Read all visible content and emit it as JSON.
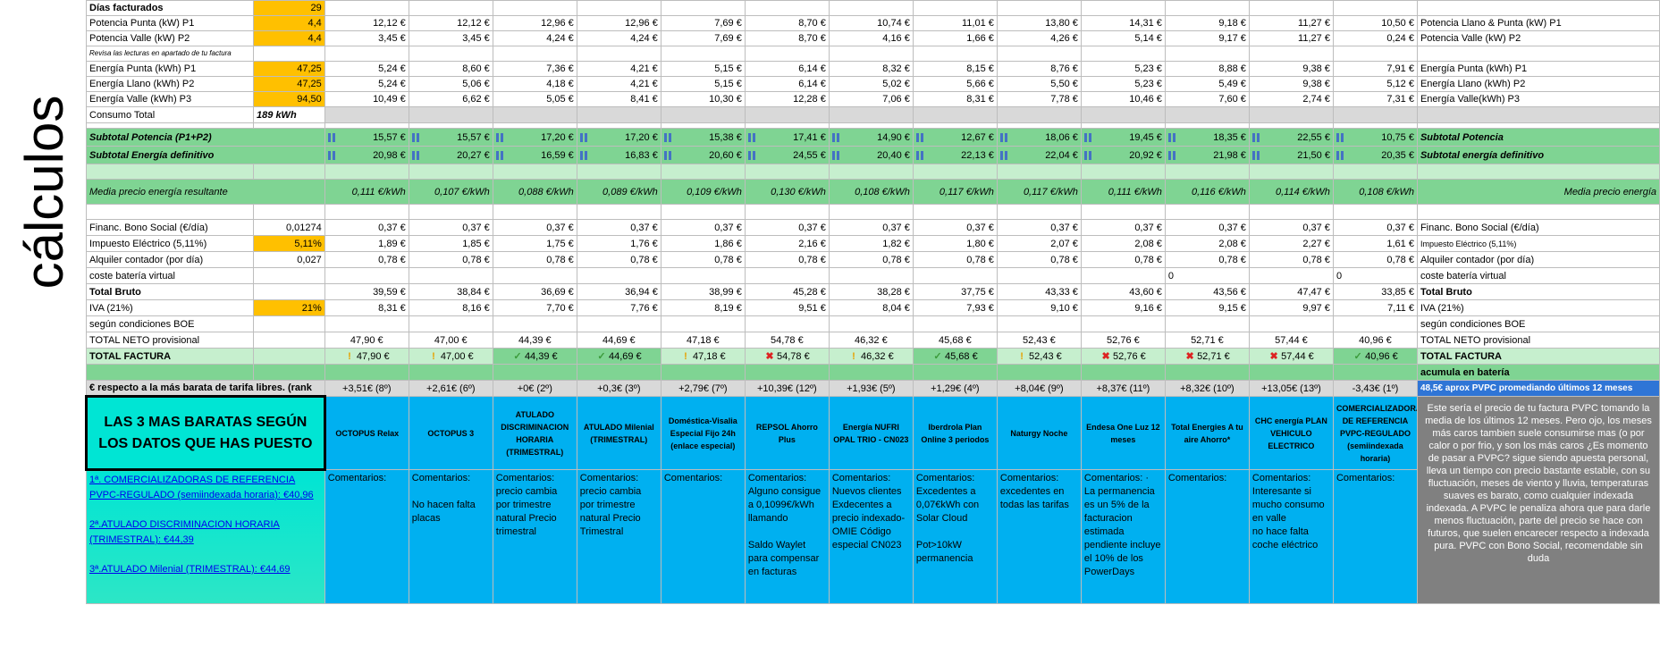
{
  "side_label": "cálculos",
  "providers": [
    {
      "name": "OCTOPUS Relax",
      "comment": "Comentarios:",
      "rank": "+3,51€ (8º)",
      "total": "47,90 €",
      "status": "warn"
    },
    {
      "name": "OCTOPUS 3",
      "comment": "Comentarios:\n\nNo hacen falta placas",
      "rank": "+2,61€ (6º)",
      "total": "47,00 €",
      "status": "warn"
    },
    {
      "name": "ATULADO DISCRIMINACION HORARIA (TRIMESTRAL)",
      "comment": "Comentarios: precio cambia por trimestre natural Precio trimestral",
      "rank": "+0€ (2º)",
      "total": "44,39 €",
      "status": "ok"
    },
    {
      "name": "ATULADO Milenial (TRIMESTRAL)",
      "comment": "Comentarios: precio cambia por trimestre natural Precio Trimestral",
      "rank": "+0,3€ (3º)",
      "total": "44,69 €",
      "status": "ok"
    },
    {
      "name": "Doméstica-Visalia Especial Fijo 24h (enlace especial)",
      "comment": "Comentarios:",
      "rank": "+2,79€ (7º)",
      "total": "47,18 €",
      "status": "warn"
    },
    {
      "name": "REPSOL Ahorro Plus",
      "comment": "Comentarios: Alguno consigue a 0,1099€/kWh llamando\n\nSaldo Waylet para compensar en facturas",
      "rank": "+10,39€ (12º)",
      "total": "54,78 €",
      "status": "x"
    },
    {
      "name": "Energía NUFRI OPAL TRIO - CN023",
      "comment": "Comentarios: Nuevos clientes Exdecentes a precio indexado-OMIE Código especial CN023",
      "rank": "+1,93€ (5º)",
      "total": "46,32 €",
      "status": "warn"
    },
    {
      "name": "Iberdrola Plan Online 3 periodos",
      "comment": "Comentarios: Excedentes a 0,07€kWh con Solar Cloud\n\nPot>10kW permanencia",
      "rank": "+1,29€ (4º)",
      "total": "45,68 €",
      "status": "ok"
    },
    {
      "name": "Naturgy Noche",
      "comment": "Comentarios: excedentes en todas las tarifas",
      "rank": "+8,04€ (9º)",
      "total": "52,43 €",
      "status": "warn"
    },
    {
      "name": "Endesa One Luz 12 meses",
      "comment": "Comentarios: · La permanencia es un 5% de la facturacion estimada pendiente incluye el 10% de los PowerDays",
      "rank": "+8,37€ (11º)",
      "total": "52,76 €",
      "status": "x"
    },
    {
      "name": "Total Energies A tu aire Ahorro*",
      "comment": "Comentarios:",
      "rank": "+8,32€ (10º)",
      "total": "52,71 €",
      "status": "x"
    },
    {
      "name": "CHC energía PLAN VEHICULO ELECTRICO",
      "comment": "Comentarios: Interesante si mucho consumo en valle\nno hace falta coche eléctrico",
      "rank": "+13,05€ (13º)",
      "total": "57,44 €",
      "status": "x"
    },
    {
      "name": "COMERCIALIZADORAS DE REFERENCIA PVPC-REGULADO (semiindexada horaria)",
      "comment": "Comentarios:",
      "rank": "-3,43€ (1º)",
      "total": "40,96 €",
      "status": "ok"
    }
  ],
  "rows": [
    {
      "label": "Días facturados",
      "input": "29",
      "input_style": "yellow",
      "label_style": "b",
      "vals": [
        "",
        "",
        "",
        "",
        "",
        "",
        "",
        "",
        "",
        "",
        "",
        "",
        ""
      ],
      "right": ""
    },
    {
      "label": "Potencia Punta (kW) P1",
      "input": "4,4",
      "input_style": "yellow",
      "vals": [
        "12,12 €",
        "12,12 €",
        "12,96 €",
        "12,96 €",
        "7,69 €",
        "8,70 €",
        "10,74 €",
        "11,01 €",
        "13,80 €",
        "14,31 €",
        "9,18 €",
        "11,27 €",
        "10,50 €"
      ],
      "right": "Potencia Llano & Punta (kW) P1"
    },
    {
      "label": "Potencia Valle (kW) P2",
      "input": "4,4",
      "input_style": "yellow",
      "vals": [
        "3,45 €",
        "3,45 €",
        "4,24 €",
        "4,24 €",
        "7,69 €",
        "8,70 €",
        "4,16 €",
        "1,66 €",
        "4,26 €",
        "5,14 €",
        "9,17 €",
        "11,27 €",
        "0,24 €"
      ],
      "right": "Potencia Valle (kW) P2"
    },
    {
      "label": "Revisa las lecturas en apartado de tu factura",
      "input": "",
      "label_style": "tiny",
      "vals": [
        "",
        "",
        "",
        "",
        "",
        "",
        "",
        "",
        "",
        "",
        "",
        "",
        ""
      ],
      "right": ""
    },
    {
      "label": "Energía Punta (kWh) P1",
      "input": "47,25",
      "input_style": "yellow",
      "vals": [
        "5,24 €",
        "8,60 €",
        "7,36 €",
        "4,21 €",
        "5,15 €",
        "6,14 €",
        "8,32 €",
        "8,15 €",
        "8,76 €",
        "5,23 €",
        "8,88 €",
        "9,38 €",
        "7,91 €"
      ],
      "right": "Energía Punta (kWh) P1"
    },
    {
      "label": "Energía Llano (kWh) P2",
      "input": "47,25",
      "input_style": "yellow",
      "vals": [
        "5,24 €",
        "5,06 €",
        "4,18 €",
        "4,21 €",
        "5,15 €",
        "6,14 €",
        "5,02 €",
        "5,66 €",
        "5,50 €",
        "5,23 €",
        "5,49 €",
        "9,38 €",
        "5,12 €"
      ],
      "right": "Energía Llano (kWh) P2"
    },
    {
      "label": "Energía Valle (kWh) P3",
      "input": "94,50",
      "input_style": "yellow",
      "vals": [
        "10,49 €",
        "6,62 €",
        "5,05 €",
        "8,41 €",
        "10,30 €",
        "12,28 €",
        "7,06 €",
        "8,31 €",
        "7,78 €",
        "10,46 €",
        "7,60 €",
        "2,74 €",
        "7,31 €"
      ],
      "right": "Energía Valle(kWh) P3"
    }
  ],
  "consumo": {
    "label": "Consumo Total",
    "value": "189 kWh"
  },
  "subtotal_potencia": {
    "label": "Subtotal Potencia (P1+P2)",
    "vals": [
      "15,57 €",
      "15,57 €",
      "17,20 €",
      "17,20 €",
      "15,38 €",
      "17,41 €",
      "14,90 €",
      "12,67 €",
      "18,06 €",
      "19,45 €",
      "18,35 €",
      "22,55 €",
      "10,75 €"
    ],
    "right": "Subtotal Potencia"
  },
  "subtotal_energia": {
    "label": "Subtotal Energía definitivo",
    "vals": [
      "20,98 €",
      "20,27 €",
      "16,59 €",
      "16,83 €",
      "20,60 €",
      "24,55 €",
      "20,40 €",
      "22,13 €",
      "22,04 €",
      "20,92 €",
      "21,98 €",
      "21,50 €",
      "20,35 €"
    ],
    "right": "Subtotal energía definitivo"
  },
  "media": {
    "label": "Media precio energía resultante",
    "vals": [
      "0,111 €/kWh",
      "0,107 €/kWh",
      "0,088 €/kWh",
      "0,089 €/kWh",
      "0,109 €/kWh",
      "0,130 €/kWh",
      "0,108 €/kWh",
      "0,117 €/kWh",
      "0,117 €/kWh",
      "0,111 €/kWh",
      "0,116 €/kWh",
      "0,114 €/kWh",
      "0,108 €/kWh"
    ],
    "right": "Media precio energía"
  },
  "rows2": [
    {
      "label": "Financ. Bono Social (€/día)",
      "input": "0,01274",
      "input_style": "",
      "vals": [
        "0,37 €",
        "0,37 €",
        "0,37 €",
        "0,37 €",
        "0,37 €",
        "0,37 €",
        "0,37 €",
        "0,37 €",
        "0,37 €",
        "0,37 €",
        "0,37 €",
        "0,37 €",
        "0,37 €"
      ],
      "right": "Financ. Bono Social (€/día)",
      "right_small": false
    },
    {
      "label": "Impuesto Eléctrico (5,11%)",
      "input": "5,11%",
      "input_style": "yellow",
      "vals": [
        "1,89 €",
        "1,85 €",
        "1,75 €",
        "1,76 €",
        "1,86 €",
        "2,16 €",
        "1,82 €",
        "1,80 €",
        "2,07 €",
        "2,08 €",
        "2,08 €",
        "2,27 €",
        "1,61 €"
      ],
      "right": "Impuesto Eléctrico (5,11%)",
      "right_small": true
    },
    {
      "label": "Alquiler contador (por día)",
      "input": "0,027",
      "input_style": "",
      "vals": [
        "0,78 €",
        "0,78 €",
        "0,78 €",
        "0,78 €",
        "0,78 €",
        "0,78 €",
        "0,78 €",
        "0,78 €",
        "0,78 €",
        "0,78 €",
        "0,78 €",
        "0,78 €",
        "0,78 €"
      ],
      "right": "Alquiler contador (por día)",
      "right_small": false
    },
    {
      "label": "coste batería virtual",
      "input": "",
      "input_style": "",
      "vals": [
        "",
        "",
        "",
        "",
        "",
        "",
        "",
        "",
        "",
        "",
        "0",
        "",
        "0"
      ],
      "right": "coste batería virtual",
      "right_small": false,
      "left_zero": true
    },
    {
      "label": "Total Bruto",
      "input": "",
      "input_style": "",
      "label_style": "b",
      "vals": [
        "39,59 €",
        "38,84 €",
        "36,69 €",
        "36,94 €",
        "38,99 €",
        "45,28 €",
        "38,28 €",
        "37,75 €",
        "43,33 €",
        "43,60 €",
        "43,56 €",
        "47,47 €",
        "33,85 €"
      ],
      "right": "Total Bruto",
      "right_bold": true
    },
    {
      "label": "IVA (21%)",
      "input": "21%",
      "input_style": "yellow",
      "vals": [
        "8,31 €",
        "8,16 €",
        "7,70 €",
        "7,76 €",
        "8,19 €",
        "9,51 €",
        "8,04 €",
        "7,93 €",
        "9,10 €",
        "9,16 €",
        "9,15 €",
        "9,97 €",
        "7,11 €"
      ],
      "right": "IVA (21%)"
    },
    {
      "label": "según condiciones BOE",
      "input": "",
      "input_style": "",
      "vals": [
        "",
        "",
        "",
        "",
        "",
        "",
        "",
        "",
        "",
        "",
        "",
        "",
        ""
      ],
      "right": "según condiciones BOE"
    },
    {
      "label": "TOTAL NETO provisional",
      "input": "",
      "input_style": "",
      "vals": [
        "47,90 €",
        "47,00 €",
        "44,39 €",
        "44,69 €",
        "47,18 €",
        "54,78 €",
        "46,32 €",
        "45,68 €",
        "52,43 €",
        "52,76 €",
        "52,71 €",
        "57,44 €",
        "40,96 €"
      ],
      "right": "TOTAL NETO provisional",
      "ctr": true
    }
  ],
  "total_factura": {
    "label": "TOTAL FACTURA",
    "right": "TOTAL FACTURA"
  },
  "bateria": "acumula en batería",
  "rank_label": "€ respecto a la más barata de tarifa libres. (rank",
  "pvpc_bar": "48,5€ aprox PVPC promediando últimos 12 meses",
  "top3_title": "LAS 3 MAS BARATAS SEGÚN LOS DATOS QUE HAS PUESTO",
  "top3_list": [
    "1ª. COMERCIALIZADORAS DE REFERENCIA PVPC-REGULADO (semiindexada horaria): €40,96",
    "2ª.ATULADO DISCRIMINACION HORARIA (TRIMESTRAL): €44,39",
    "3ª.ATULADO Milenial (TRIMESTRAL): €44,69"
  ],
  "pvpc_text": "Este sería el precio de tu factura PVPC tomando la media de los últimos 12 meses. Pero ojo, los meses más caros tambien suele consumirse mas (o por calor o por frio, y son los más caros ¿Es momento de pasar a PVPC? sigue siendo apuesta personal, lleva un tiempo con precio bastante estable, con su fluctuación, meses de viento y lluvia, temperaturas suaves es barato, como cualquier indexada indexada. A PVPC le penaliza ahora que para darle menos fluctuación, parte del precio se hace con futuros, que suelen encarecer respecto a indexada pura. PVPC con Bono Social, recomendable sin duda",
  "colors": {
    "yellow": "#ffc000",
    "green": "#7fd493",
    "blue": "#00b0f0",
    "teal": "#00e5d4",
    "pvpc": "#2f75d6"
  }
}
